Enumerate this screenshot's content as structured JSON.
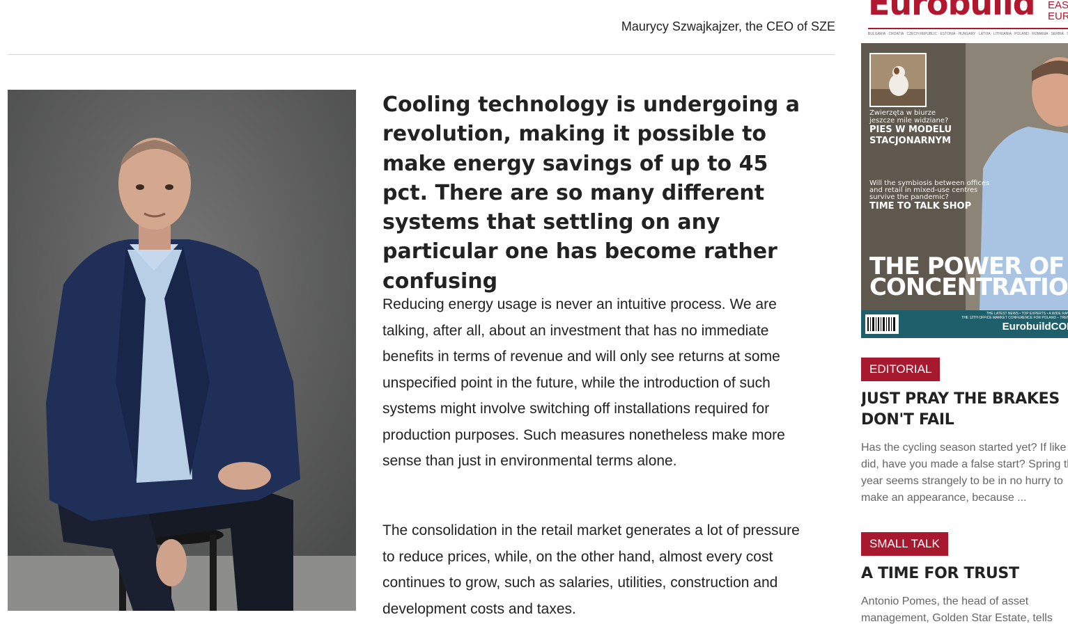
{
  "article": {
    "byline": "Maurycy Szwajkajzer, the CEO of SZE",
    "lead": "Cooling technology is undergoing a revolution, making it possible to make energy savings of up to 45 pct. There are so many different systems that settling on any particular one has become rather confusing",
    "paragraphs": [
      "Reducing energy usage is never an intuitive process. We are talking, after all, about an investment that has no immediate benefits in terms of revenue and will only see returns at some unspecified point in the future, while the introduction of such systems might involve switching off installations required for production purposes. Such measures nonetheless make more sense than just in environmental terms alone.",
      "The consolidation in the retail market generates a lot of pressure to reduce prices, while, on the other hand, almost every cost continues to grow, such as salaries, utilities, construction and development costs and taxes."
    ]
  },
  "cover": {
    "masthead": "Eurobuild",
    "masthead_side": "EAST\nEUR",
    "masthead_fine": "BULGARIA · CROATIA · CZECH REPUBLIC · ESTONIA · HUNGARY · LATVIA · LITHUANIA · POLAND · ROMANIA · SERBIA · SLOVAKIA · UKRAINE",
    "teaser1_small_1": "Zwierzęta w biurze",
    "teaser1_small_2": "jeszcze mile widziane?",
    "teaser1_bold_1": "PIES W MODELU",
    "teaser1_bold_2": "STACJONARNYM",
    "teaser2_small_1": "Will the symbiosis between offices",
    "teaser2_small_2": "and retail in mixed-use centres",
    "teaser2_small_3": "survive the pandemic?",
    "teaser2_bold": "TIME TO TALK SHOP",
    "headline_1": "THE POWER OF",
    "headline_2": "CONCENTRATION",
    "footer_text": "THE LATEST NEWS • TOP EXPERTS • A WIDE RANGE\nTHE 12TH OFFICE MARKET CONFERENCE FOR POLAND – TRENDS",
    "footer_brand": "EurobuildCON"
  },
  "sidebar": {
    "items": [
      {
        "tag": "EDITORIAL",
        "title": "JUST PRAY THE BRAKES DON'T FAIL",
        "excerpt": "Has the cycling season started yet? If like I did, have you made a false start? Spring this year seems strangely to be in no hurry to make an appearance, because ..."
      },
      {
        "tag": "SMALL TALK",
        "title": "A TIME FOR TRUST",
        "excerpt": "Antonio Pomes, the head of asset management, Golden Star Estate, tells"
      }
    ]
  },
  "colors": {
    "accent": "#a6192e",
    "teal": "#1e5f6b",
    "text": "#222222",
    "muted": "#666666"
  }
}
